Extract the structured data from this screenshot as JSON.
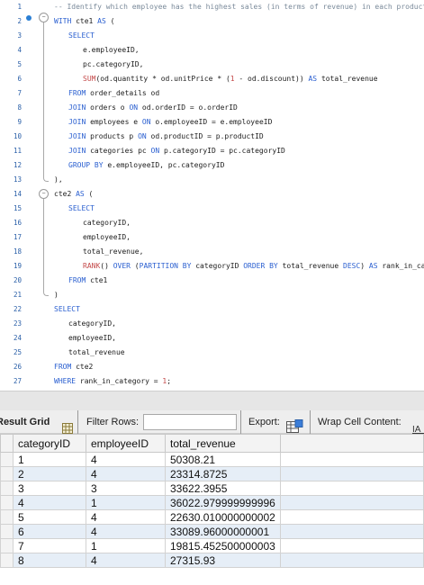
{
  "editor": {
    "lines": [
      {
        "n": "1",
        "indent": 0,
        "tokens": [
          [
            "cm",
            "-- Identify which employee has the highest sales (in terms of revenue) in each product category"
          ]
        ]
      },
      {
        "n": "2",
        "indent": 0,
        "tokens": [
          [
            "kw",
            "WITH"
          ],
          [
            "",
            " cte1 "
          ],
          [
            "kw",
            "AS"
          ],
          [
            "",
            " ("
          ]
        ]
      },
      {
        "n": "3",
        "indent": 2,
        "tokens": [
          [
            "kw",
            "SELECT"
          ]
        ]
      },
      {
        "n": "4",
        "indent": 4,
        "tokens": [
          [
            "",
            "e.employeeID,"
          ]
        ]
      },
      {
        "n": "5",
        "indent": 4,
        "tokens": [
          [
            "",
            "pc.categoryID,"
          ]
        ]
      },
      {
        "n": "6",
        "indent": 4,
        "tokens": [
          [
            "fn",
            "SUM"
          ],
          [
            "",
            "(od.quantity * od.unitPrice * ("
          ],
          [
            "num",
            "1"
          ],
          [
            "",
            " - od.discount)) "
          ],
          [
            "kw",
            "AS"
          ],
          [
            "",
            " total_revenue"
          ]
        ]
      },
      {
        "n": "7",
        "indent": 2,
        "tokens": [
          [
            "kw",
            "FROM"
          ],
          [
            "",
            " order_details od"
          ]
        ]
      },
      {
        "n": "8",
        "indent": 2,
        "tokens": [
          [
            "kw",
            "JOIN"
          ],
          [
            "",
            " orders o "
          ],
          [
            "kw",
            "ON"
          ],
          [
            "",
            " od.orderID = o.orderID"
          ]
        ]
      },
      {
        "n": "9",
        "indent": 2,
        "tokens": [
          [
            "kw",
            "JOIN"
          ],
          [
            "",
            " employees e "
          ],
          [
            "kw",
            "ON"
          ],
          [
            "",
            " o.employeeID = e.employeeID"
          ]
        ]
      },
      {
        "n": "10",
        "indent": 2,
        "tokens": [
          [
            "kw",
            "JOIN"
          ],
          [
            "",
            " products p "
          ],
          [
            "kw",
            "ON"
          ],
          [
            "",
            " od.productID = p.productID"
          ]
        ]
      },
      {
        "n": "11",
        "indent": 2,
        "tokens": [
          [
            "kw",
            "JOIN"
          ],
          [
            "",
            " categories pc "
          ],
          [
            "kw",
            "ON"
          ],
          [
            "",
            " p.categoryID = pc.categoryID"
          ]
        ]
      },
      {
        "n": "12",
        "indent": 2,
        "tokens": [
          [
            "kw",
            "GROUP BY"
          ],
          [
            "",
            " e.employeeID, pc.categoryID"
          ]
        ]
      },
      {
        "n": "13",
        "indent": 0,
        "tokens": [
          [
            "",
            "),"
          ]
        ]
      },
      {
        "n": "14",
        "indent": 0,
        "tokens": [
          [
            "",
            "cte2 "
          ],
          [
            "kw",
            "AS"
          ],
          [
            "",
            " ("
          ]
        ]
      },
      {
        "n": "15",
        "indent": 2,
        "tokens": [
          [
            "kw",
            "SELECT"
          ]
        ]
      },
      {
        "n": "16",
        "indent": 4,
        "tokens": [
          [
            "",
            "categoryID,"
          ]
        ]
      },
      {
        "n": "17",
        "indent": 4,
        "tokens": [
          [
            "",
            "employeeID,"
          ]
        ]
      },
      {
        "n": "18",
        "indent": 4,
        "tokens": [
          [
            "",
            "total_revenue,"
          ]
        ]
      },
      {
        "n": "19",
        "indent": 4,
        "tokens": [
          [
            "fn",
            "RANK"
          ],
          [
            "",
            "() "
          ],
          [
            "kw",
            "OVER"
          ],
          [
            "",
            " ("
          ],
          [
            "kw",
            "PARTITION BY"
          ],
          [
            "",
            " categoryID "
          ],
          [
            "kw",
            "ORDER BY"
          ],
          [
            "",
            " total_revenue "
          ],
          [
            "kw",
            "DESC"
          ],
          [
            "",
            ") "
          ],
          [
            "kw",
            "AS"
          ],
          [
            "",
            " rank_in_category"
          ]
        ]
      },
      {
        "n": "20",
        "indent": 2,
        "tokens": [
          [
            "kw",
            "FROM"
          ],
          [
            "",
            " cte1"
          ]
        ]
      },
      {
        "n": "21",
        "indent": 0,
        "tokens": [
          [
            "",
            ")"
          ]
        ]
      },
      {
        "n": "22",
        "indent": 0,
        "tokens": [
          [
            "kw",
            "SELECT"
          ]
        ]
      },
      {
        "n": "23",
        "indent": 2,
        "tokens": [
          [
            "",
            "categoryID,"
          ]
        ]
      },
      {
        "n": "24",
        "indent": 2,
        "tokens": [
          [
            "",
            "employeeID,"
          ]
        ]
      },
      {
        "n": "25",
        "indent": 2,
        "tokens": [
          [
            "",
            "total_revenue"
          ]
        ]
      },
      {
        "n": "26",
        "indent": 0,
        "tokens": [
          [
            "kw",
            "FROM"
          ],
          [
            "",
            " cte2"
          ]
        ]
      },
      {
        "n": "27",
        "indent": 0,
        "tokens": [
          [
            "kw",
            "WHERE"
          ],
          [
            "",
            " rank_in_category = "
          ],
          [
            "num",
            "1"
          ],
          [
            "",
            ";"
          ]
        ]
      }
    ]
  },
  "toolbar": {
    "result_grid_label": "Result Grid",
    "filter_rows_label": "Filter Rows:",
    "filter_rows_value": "",
    "export_label": "Export:",
    "wrap_cell_label": "Wrap Cell Content:"
  },
  "grid": {
    "columns": [
      "categoryID",
      "employeeID",
      "total_revenue"
    ],
    "rows": [
      [
        "1",
        "4",
        "50308.21"
      ],
      [
        "2",
        "4",
        "23314.8725"
      ],
      [
        "3",
        "3",
        "33622.3955"
      ],
      [
        "4",
        "1",
        "36022.979999999996"
      ],
      [
        "5",
        "4",
        "22630.010000000002"
      ],
      [
        "6",
        "4",
        "33089.96000000001"
      ],
      [
        "7",
        "1",
        "19815.452500000003"
      ],
      [
        "8",
        "4",
        "27315.93"
      ]
    ]
  }
}
